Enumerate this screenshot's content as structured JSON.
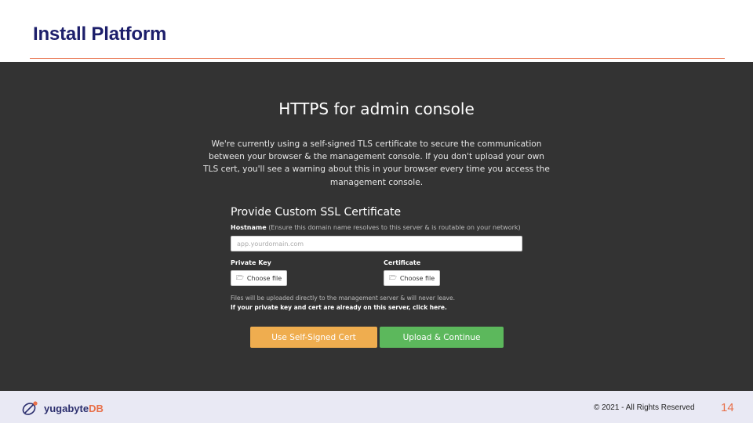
{
  "slide": {
    "title": "Install Platform"
  },
  "console": {
    "heading": "HTTPS for admin console",
    "intro": "We're currently using a self-signed TLS certificate to secure the communication between your browser & the management console. If you don't upload your own TLS cert, you'll see a warning about this in your browser every time you access the management console.",
    "form_title": "Provide Custom SSL Certificate",
    "hostname": {
      "label": "Hostname",
      "note": "(Ensure this domain name resolves to this server & is routable on your network)",
      "placeholder": "app.yourdomain.com",
      "value": ""
    },
    "private_key": {
      "label": "Private Key",
      "button_label": "Choose file",
      "icon": "folder-open-icon"
    },
    "certificate": {
      "label": "Certificate",
      "button_label": "Choose file",
      "icon": "folder-open-icon"
    },
    "upload_note": "Files will be uploaded directly to the management server & will never leave.",
    "already_on_server_link": "If your private key and cert are already on this server, click here.",
    "buttons": {
      "self_signed": "Use Self-Signed Cert",
      "upload_continue": "Upload & Continue"
    },
    "colors": {
      "background": "#333333",
      "self_signed_button": "#efad4f",
      "upload_button": "#5cb85c"
    }
  },
  "footer": {
    "logo_text_main": "yugabyte",
    "logo_text_db": "DB",
    "copyright": "© 2021 - All Rights Reserved",
    "page_number": "14",
    "colors": {
      "brand_navy": "#2c2f6e",
      "brand_orange": "#e8704a"
    }
  }
}
